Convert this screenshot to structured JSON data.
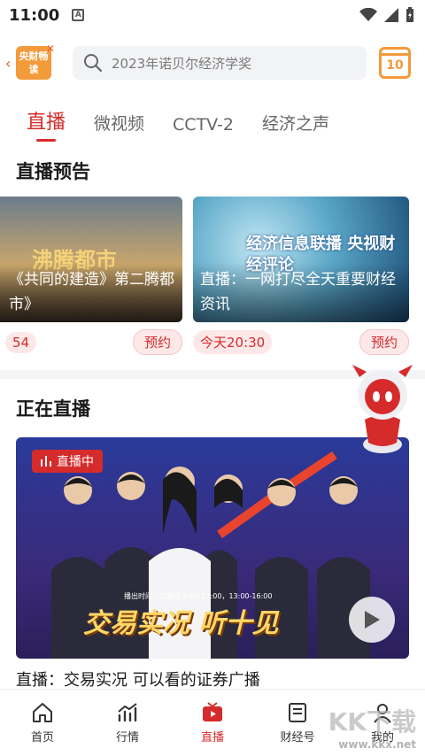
{
  "status": {
    "time": "11:00",
    "badge": "A"
  },
  "header": {
    "logo_text": "央财畅读",
    "search_placeholder": "2023年诺贝尔经济学奖",
    "calendar_day": "10"
  },
  "tabs": [
    {
      "label": "直播",
      "active": true
    },
    {
      "label": "微视频"
    },
    {
      "label": "CCTV-2"
    },
    {
      "label": "经济之声"
    }
  ],
  "preview": {
    "title": "直播预告",
    "cards": [
      {
        "caption": "《共同的建造》第二腾都市》",
        "thumb_text": "沸腾都市",
        "time": "54",
        "action": "预约"
      },
      {
        "caption": "直播：一网打尽全天重要财经资讯",
        "thumb_text": "经济信息联播 央视财经评论",
        "time": "今天20:30",
        "action": "预约"
      }
    ]
  },
  "live": {
    "title": "正在直播",
    "badge": "直播中",
    "show_title": "交易实况 听十见",
    "air_time": "播出时间：交易日 9:00-12:00，13:00-16:00",
    "description": "直播：交易实况 可以看的证券广播"
  },
  "bottom_nav": [
    {
      "label": "首页",
      "icon": "home-icon"
    },
    {
      "label": "行情",
      "icon": "chart-icon"
    },
    {
      "label": "直播",
      "icon": "tv-icon",
      "active": true
    },
    {
      "label": "财经号",
      "icon": "document-icon"
    },
    {
      "label": "我的",
      "icon": "user-icon"
    }
  ],
  "watermark": {
    "main": "KK下载",
    "sub": "www.kkx.net"
  },
  "colors": {
    "accent": "#d62b2b",
    "orange": "#f39a3a"
  }
}
